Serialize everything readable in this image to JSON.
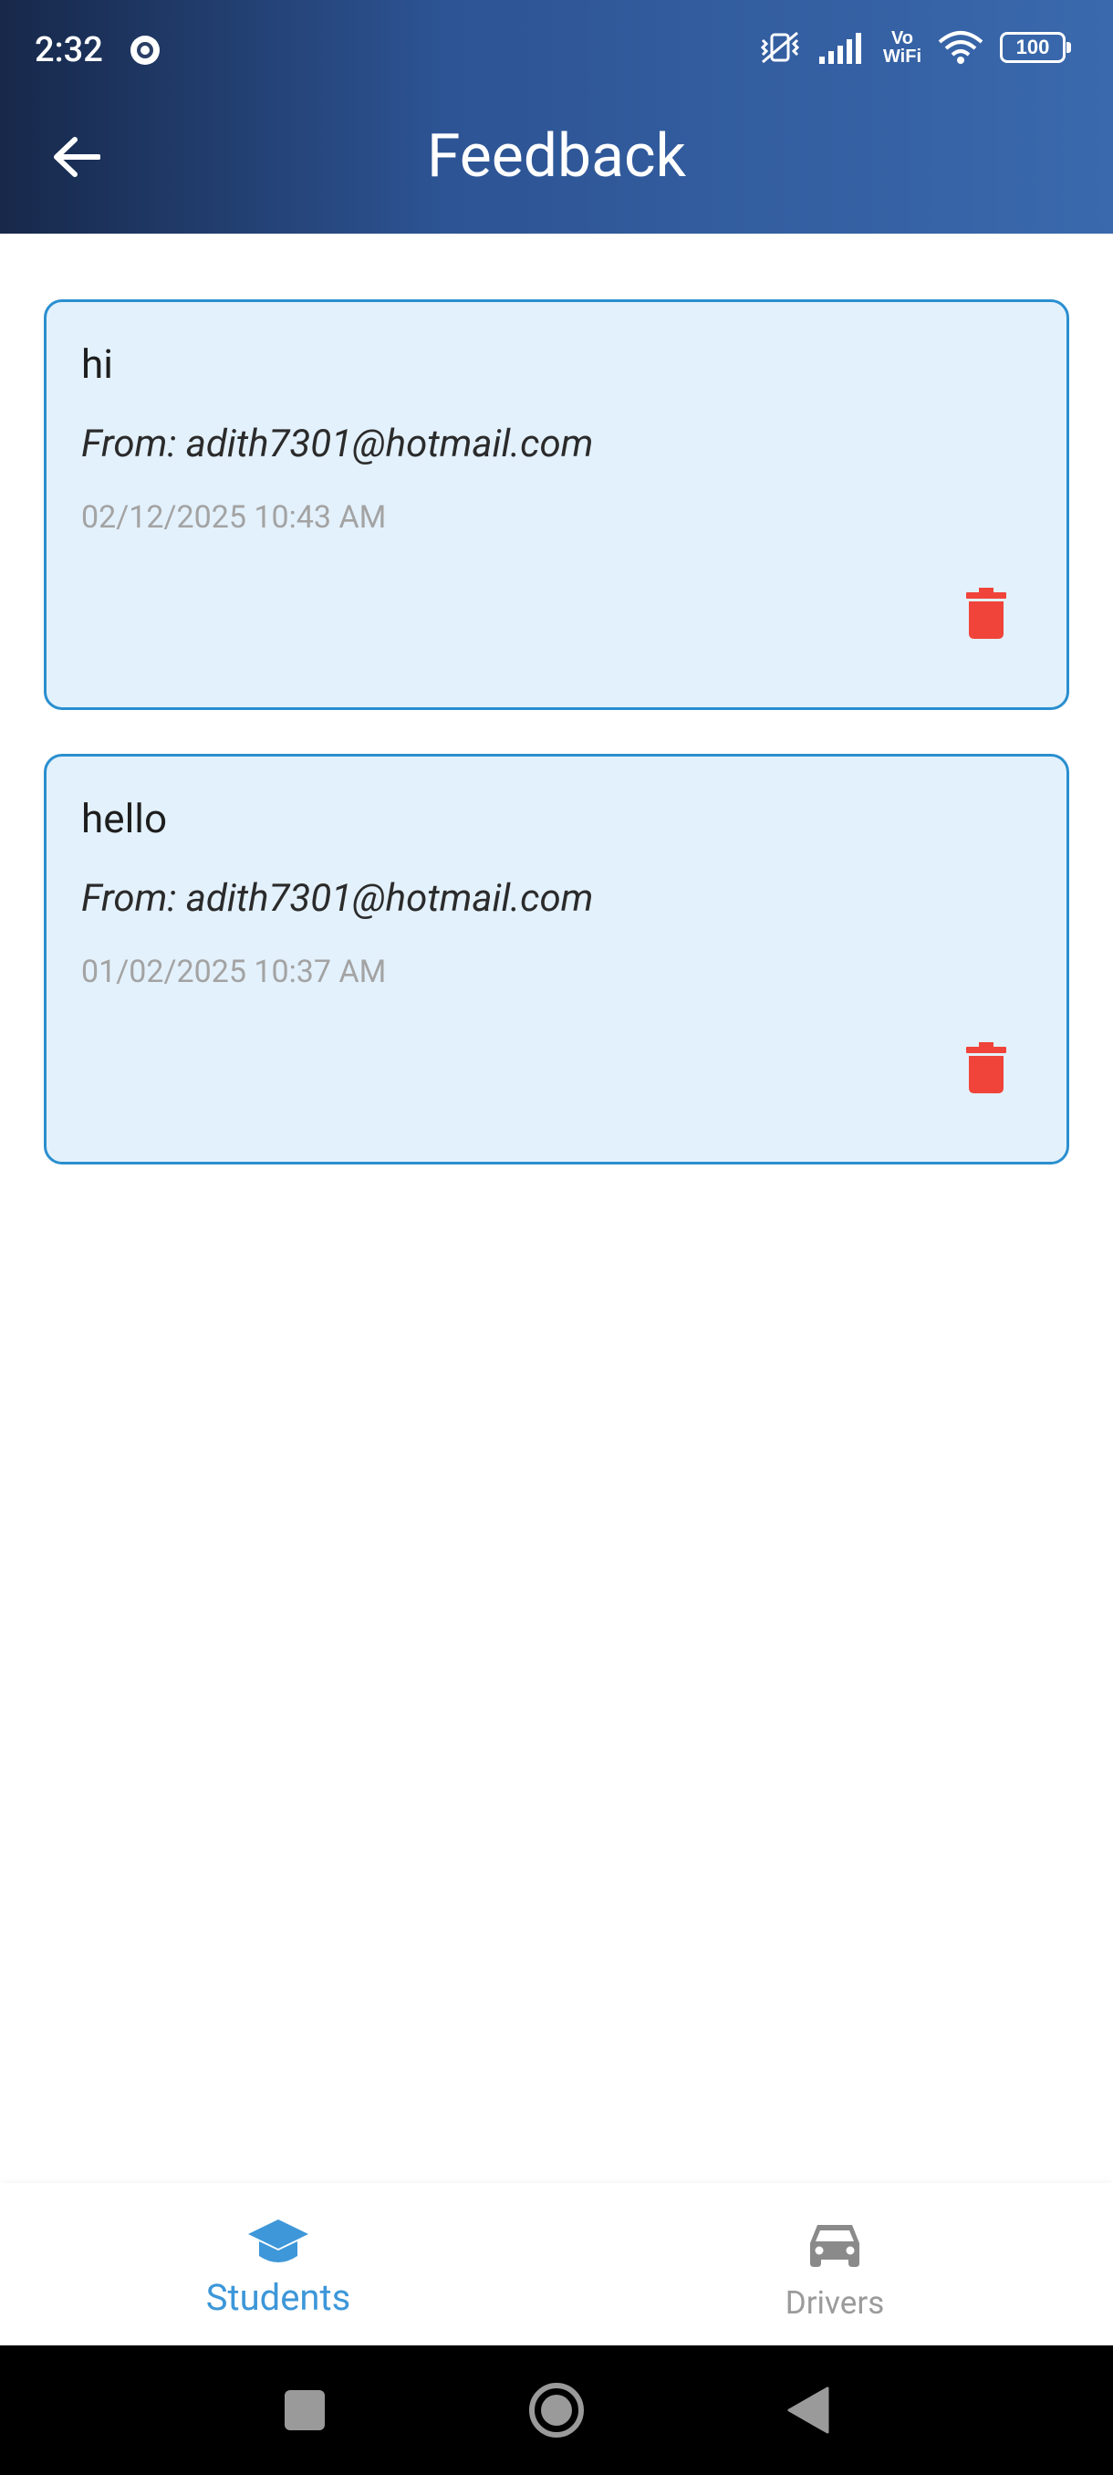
{
  "status_bar": {
    "time": "2:32",
    "vo_label": "Vo",
    "wifi_label": "WiFi",
    "battery": "100"
  },
  "header": {
    "title": "Feedback",
    "back_icon": "arrow-left-icon"
  },
  "feedback": [
    {
      "message": "hi",
      "from": "From: adith7301@hotmail.com",
      "date": "02/12/2025 10:43 AM"
    },
    {
      "message": "hello",
      "from": "From: adith7301@hotmail.com",
      "date": "01/02/2025 10:37 AM"
    }
  ],
  "bottom_nav": {
    "students_label": "Students",
    "drivers_label": "Drivers",
    "active": "Students"
  },
  "colors": {
    "accent": "#3d97d9",
    "card_bg": "#e3f1fc",
    "card_border": "#2a8fcf",
    "delete": "#f0443a"
  }
}
